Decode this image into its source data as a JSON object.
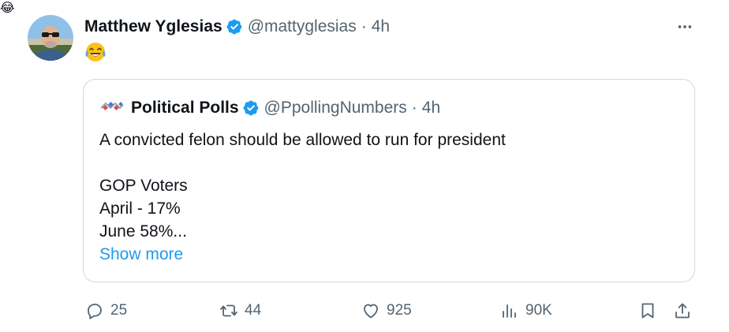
{
  "tweet": {
    "author_name": "Matthew Yglesias",
    "author_handle": "@mattyglesias",
    "separator": "·",
    "time": "4h",
    "text": "😂"
  },
  "quoted": {
    "author_name": "Political Polls",
    "author_handle": "@PpollingNumbers",
    "separator": "·",
    "time": "4h",
    "lines": [
      "A convicted felon should be allowed to run for president",
      "GOP Voters",
      "April - 17%",
      "June 58%..."
    ],
    "show_more": "Show more"
  },
  "actions": {
    "replies": "25",
    "reposts": "44",
    "likes": "925",
    "views": "90K"
  },
  "colors": {
    "text_primary": "#0f1419",
    "text_secondary": "#536471",
    "verified_blue": "#1d9bf0",
    "link_blue": "#1d9bf0",
    "border": "#cfd9de"
  },
  "icons": {
    "more": "more-dots-icon",
    "verified": "verified-badge-icon",
    "reply": "reply-icon",
    "repost": "repost-icon",
    "like": "heart-icon",
    "views": "views-chart-icon",
    "bookmark": "bookmark-icon",
    "share": "share-icon"
  }
}
